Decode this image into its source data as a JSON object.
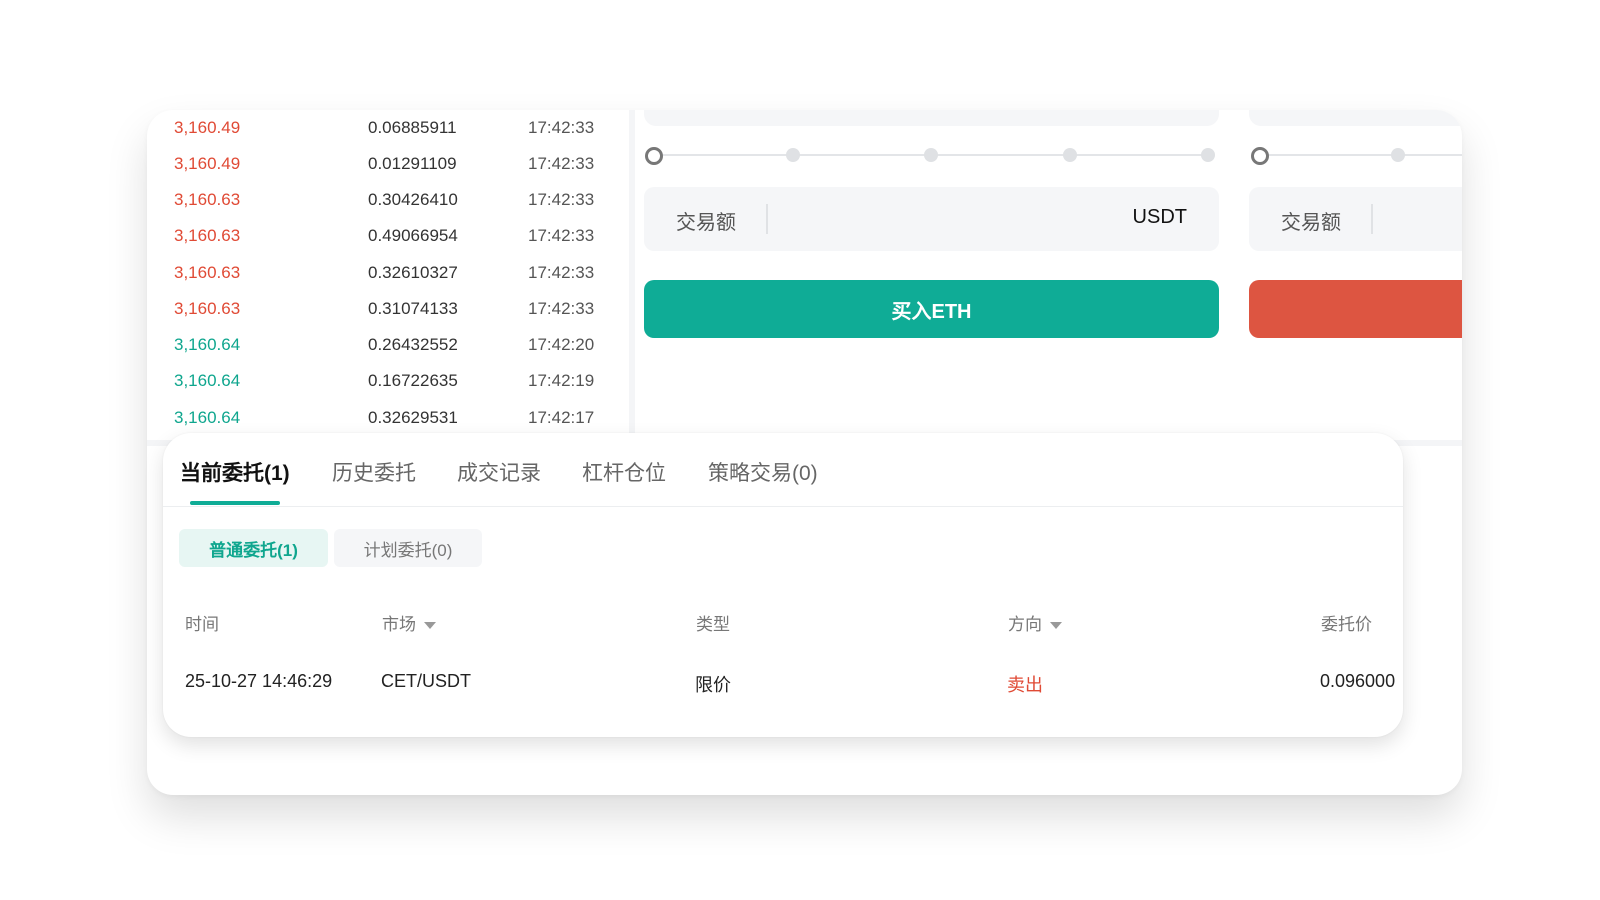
{
  "trades": [
    {
      "price": "3,160.49",
      "amount": "0.06885911",
      "time": "17:42:33",
      "side": "up"
    },
    {
      "price": "3,160.49",
      "amount": "0.01291109",
      "time": "17:42:33",
      "side": "up"
    },
    {
      "price": "3,160.63",
      "amount": "0.30426410",
      "time": "17:42:33",
      "side": "up"
    },
    {
      "price": "3,160.63",
      "amount": "0.49066954",
      "time": "17:42:33",
      "side": "up"
    },
    {
      "price": "3,160.63",
      "amount": "0.32610327",
      "time": "17:42:33",
      "side": "up"
    },
    {
      "price": "3,160.63",
      "amount": "0.31074133",
      "time": "17:42:33",
      "side": "up"
    },
    {
      "price": "3,160.64",
      "amount": "0.26432552",
      "time": "17:42:20",
      "side": "down"
    },
    {
      "price": "3,160.64",
      "amount": "0.16722635",
      "time": "17:42:19",
      "side": "down"
    },
    {
      "price": "3,160.64",
      "amount": "0.32629531",
      "time": "17:42:17",
      "side": "down"
    }
  ],
  "buy_form": {
    "amount_label": "交易额",
    "amount_unit": "USDT",
    "buy_label": "买入ETH"
  },
  "sell_form": {
    "amount_label": "交易额"
  },
  "orders": {
    "tabs": [
      "当前委托(1)",
      "历史委托",
      "成交记录",
      "杠杆仓位",
      "策略交易(0)"
    ],
    "subtabs": [
      "普通委托(1)",
      "计划委托(0)"
    ],
    "columns": {
      "time": "时间",
      "market": "市场",
      "type": "类型",
      "direction": "方向",
      "price": "委托价"
    },
    "rows": [
      {
        "time": "25-10-27 14:46:29",
        "market": "CET/USDT",
        "type": "限价",
        "direction": "卖出",
        "price": "0.096000"
      }
    ]
  },
  "colors": {
    "buy": "#0fac96",
    "sell": "#dd5541",
    "price_up": "#e04a35",
    "price_down": "#0fa68e"
  }
}
